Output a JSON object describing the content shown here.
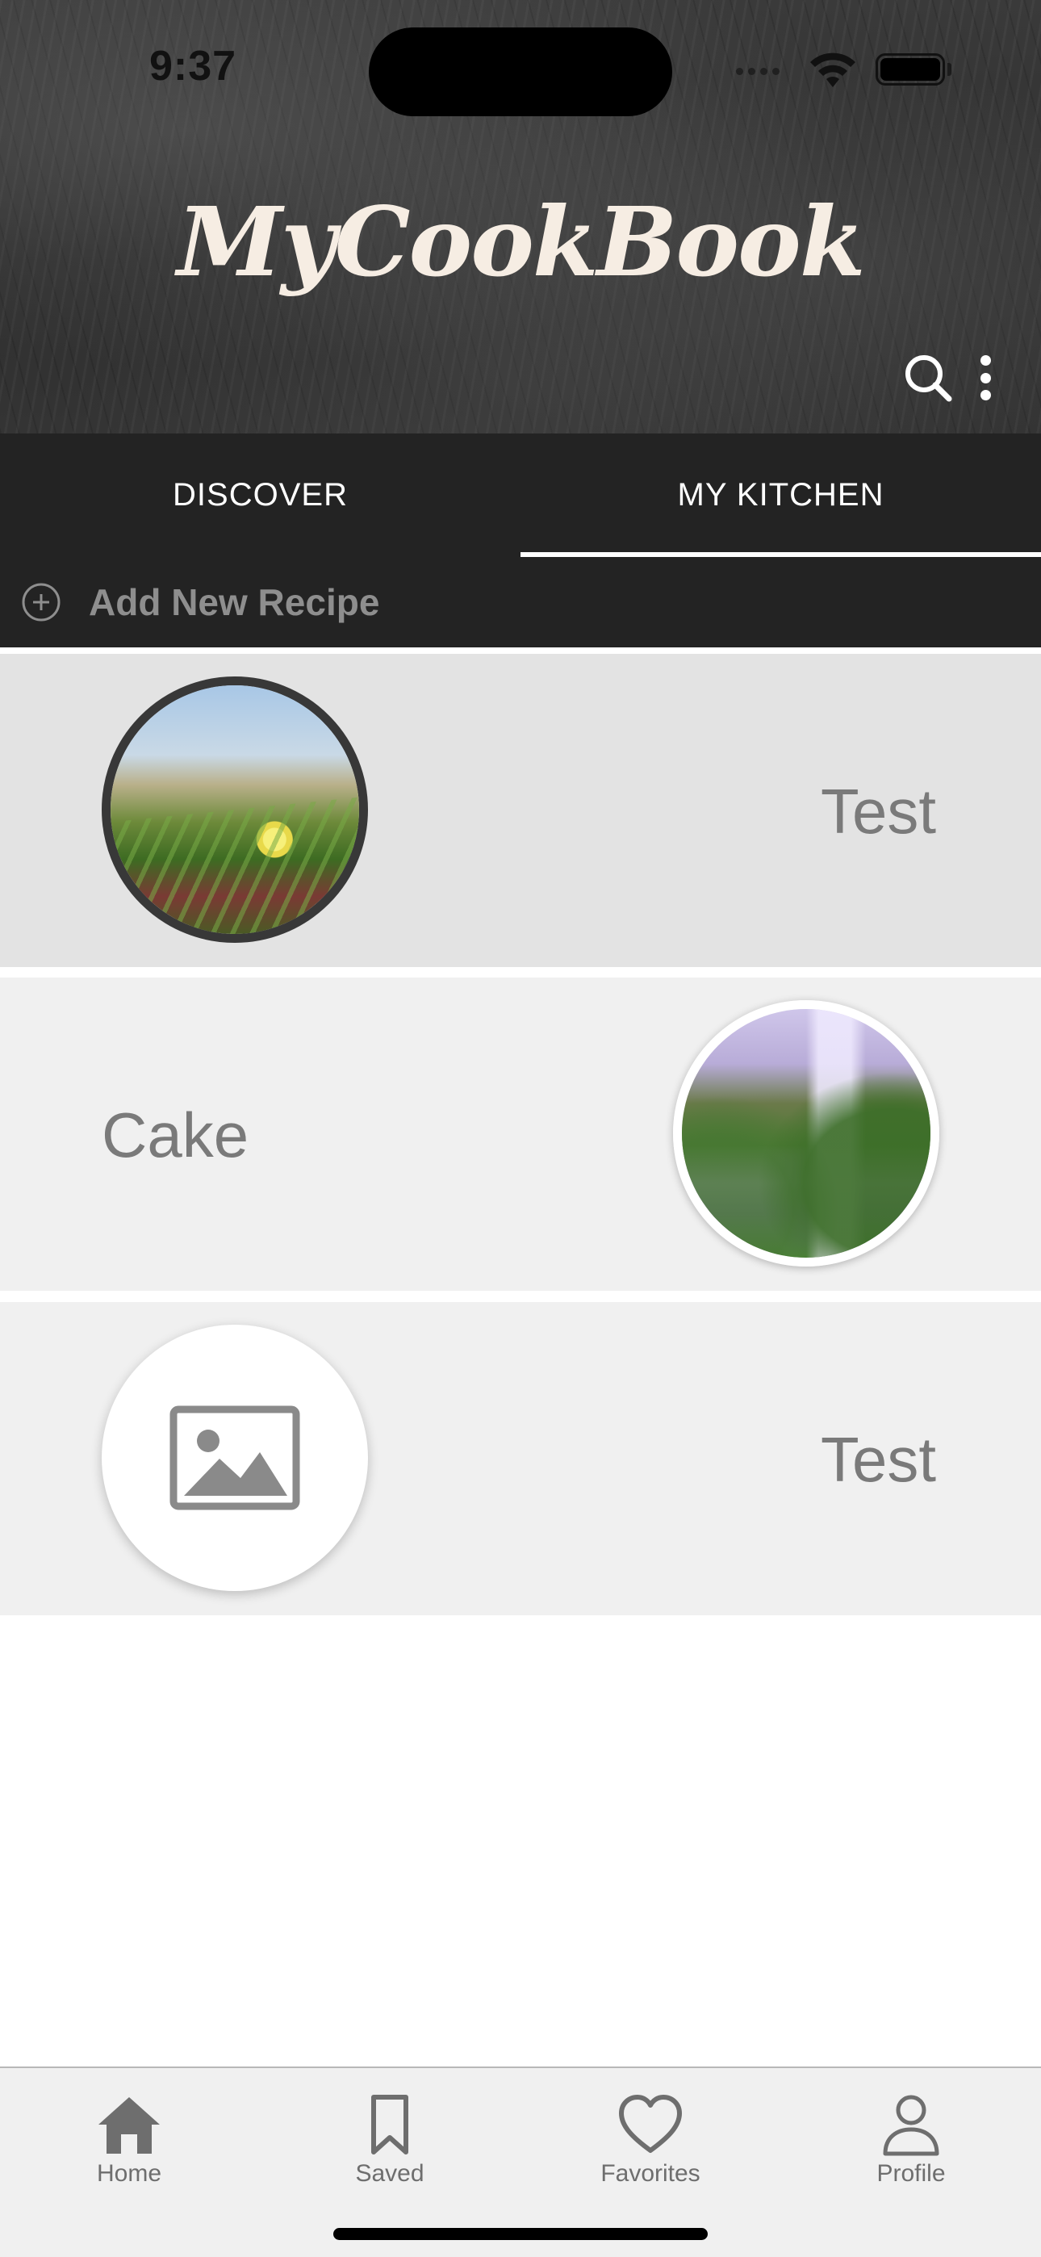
{
  "status_bar": {
    "time": "9:37"
  },
  "header": {
    "app_title": "MyCookBook"
  },
  "tabs": [
    {
      "label": "DISCOVER",
      "active": false
    },
    {
      "label": "MY KITCHEN",
      "active": true
    }
  ],
  "add_recipe": {
    "label": "Add New Recipe",
    "icon": "plus-circle-icon"
  },
  "recipes": [
    {
      "name": "Test",
      "image": "flower-photo",
      "selected": true
    },
    {
      "name": "Cake",
      "image": "waterfall-photo",
      "selected": false
    },
    {
      "name": "Test",
      "image": "image-placeholder-icon",
      "selected": false
    }
  ],
  "bottom_nav": [
    {
      "label": "Home",
      "icon": "home-icon",
      "active": true
    },
    {
      "label": "Saved",
      "icon": "bookmark-icon",
      "active": false
    },
    {
      "label": "Favorites",
      "icon": "heart-icon",
      "active": false
    },
    {
      "label": "Profile",
      "icon": "person-icon",
      "active": false
    }
  ],
  "colors": {
    "header_bg": "#2e2e2e",
    "tab_bar_bg": "#232323",
    "title_text": "#f6ede3",
    "row_bg": "#f0f0f0",
    "row_selected_bg": "#e3e3e3",
    "recipe_text": "#7a7a7a"
  }
}
